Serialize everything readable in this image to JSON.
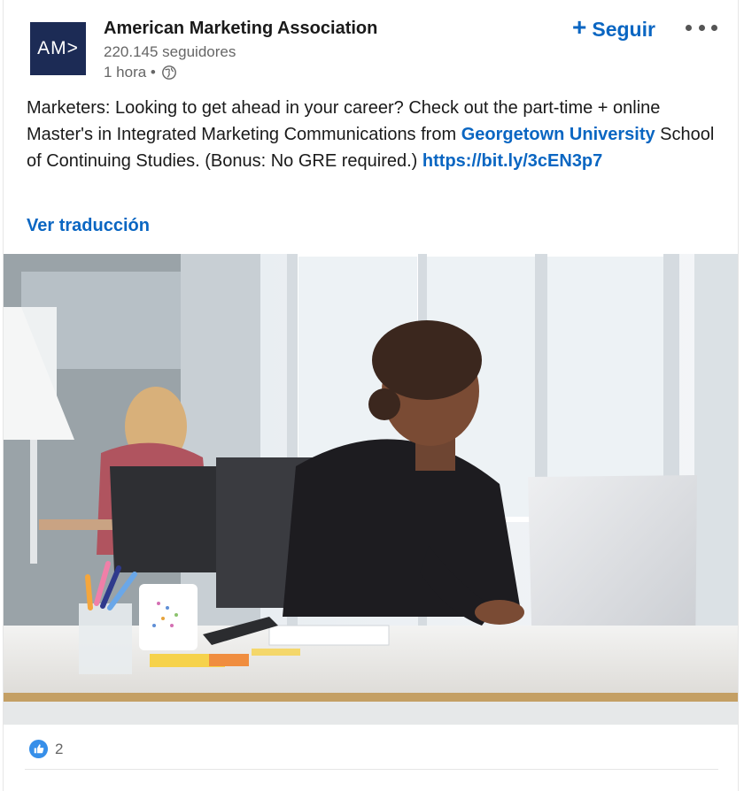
{
  "post": {
    "org_name": "American Marketing Association",
    "logo_text": "AM>",
    "followers": "220.145 seguidores",
    "time": "1 hora •",
    "follow_label": "Seguir",
    "text_part1": "Marketers: Looking to get ahead in your career? Check out the part-time + online Master's in Integrated Marketing Communications from ",
    "link_org": "Georgetown University",
    "text_part2": " School of Continuing Studies. (Bonus: No GRE required.) ",
    "link_url": "https://bit.ly/3cEN3p7",
    "translate_label": "Ver traducción",
    "reaction_count": "2"
  },
  "colors": {
    "brand_blue": "#0a66c2",
    "logo_bg": "#1c2b55"
  },
  "icons": [
    "globe-icon",
    "plus-icon",
    "more-icon",
    "like-icon"
  ]
}
